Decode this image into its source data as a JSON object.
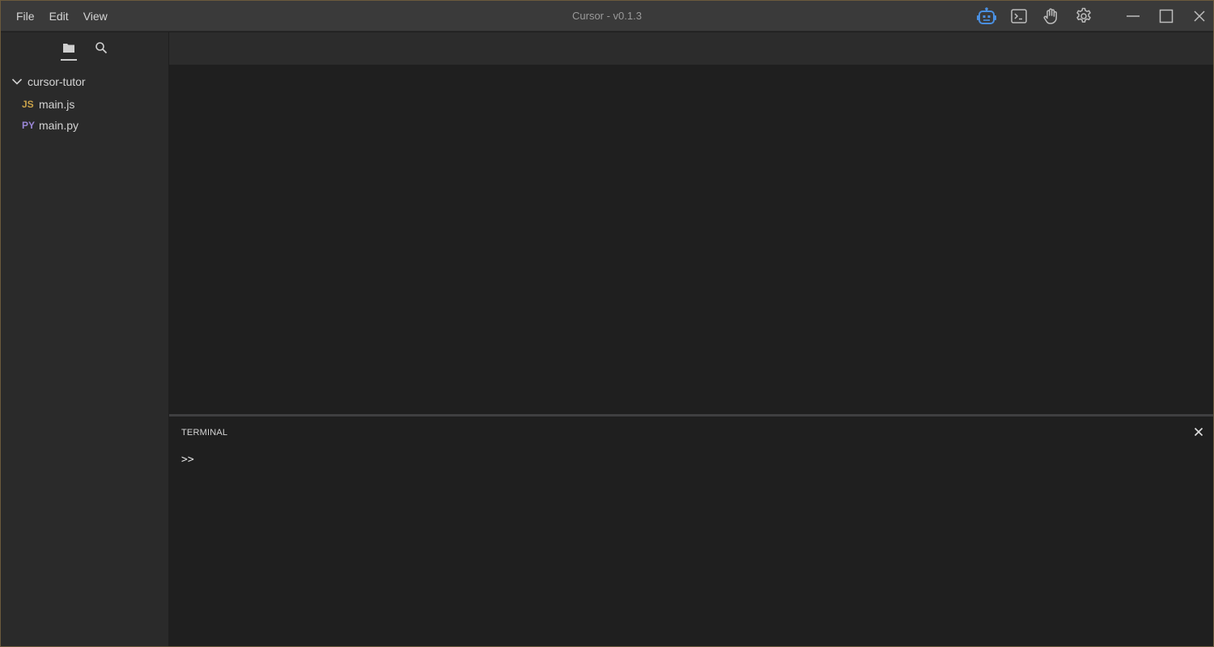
{
  "window": {
    "title": "Cursor - v0.1.3"
  },
  "menu": {
    "items": [
      "File",
      "Edit",
      "View"
    ]
  },
  "toolbar": {
    "icons": [
      "robot-icon",
      "terminal-icon",
      "hand-icon",
      "gear-icon"
    ],
    "accent_color": "#4a8fe0"
  },
  "window_controls": [
    "minimize",
    "maximize",
    "close"
  ],
  "sidebar": {
    "tabs": [
      "explorer",
      "search"
    ],
    "folder": {
      "name": "cursor-tutor",
      "expanded": true
    },
    "files": [
      {
        "badge": "JS",
        "name": "main.js",
        "badge_color": "#c9a24a"
      },
      {
        "badge": "PY",
        "name": "main.py",
        "badge_color": "#9a86d6"
      }
    ]
  },
  "terminal": {
    "title": "TERMINAL",
    "prompt": ">>"
  }
}
